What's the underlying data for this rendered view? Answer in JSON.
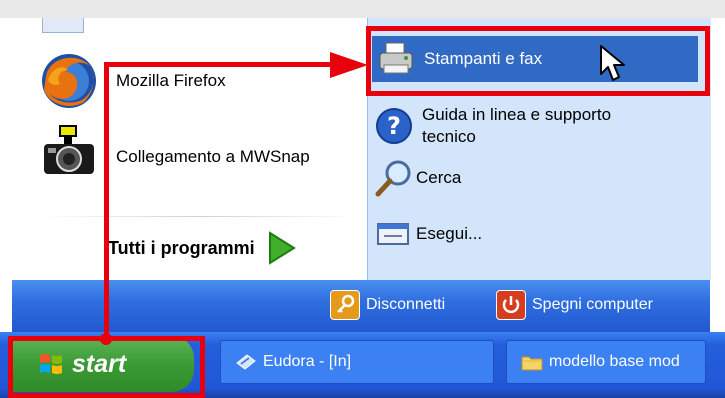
{
  "start_menu": {
    "left_items": [
      {
        "label": "Mozilla Firefox",
        "icon": "firefox-icon"
      },
      {
        "label": "Collegamento a MWSnap",
        "icon": "camera-icon"
      }
    ],
    "all_programs_label": "Tutti i programmi",
    "right_items": [
      {
        "label": "Stampanti e fax",
        "icon": "printer-icon"
      },
      {
        "label_line1": "Guida in linea e supporto",
        "label_line2": "tecnico",
        "icon": "help-icon"
      },
      {
        "label": "Cerca",
        "icon": "search-icon"
      },
      {
        "label": "Esegui...",
        "icon": "run-icon"
      }
    ],
    "logoff_label": "Disconnetti",
    "shutdown_label": "Spegni computer"
  },
  "taskbar": {
    "start_label": "start",
    "tasks": [
      {
        "label": "Eudora - [In]",
        "icon": "eudora-icon"
      },
      {
        "label": "modello base mod",
        "icon": "folder-icon"
      }
    ]
  },
  "colors": {
    "highlight": "#316ac5",
    "annotation_red": "#e8000c",
    "taskbar_blue": "#245edb",
    "start_green": "#3c9b35"
  }
}
